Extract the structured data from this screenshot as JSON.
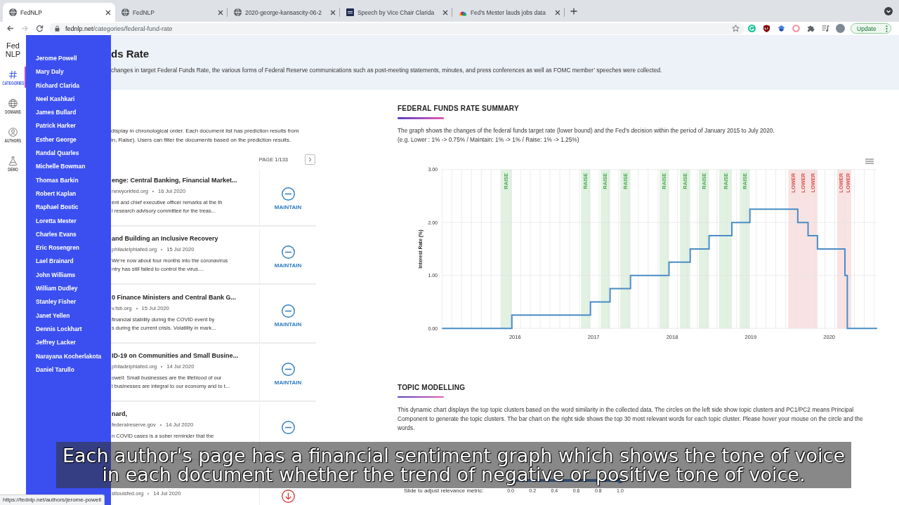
{
  "browser": {
    "tabs": [
      {
        "kind": "globe",
        "title": "FedNLP",
        "selected": true
      },
      {
        "kind": "globe",
        "title": "FedNLP",
        "selected": false
      },
      {
        "kind": "globe",
        "title": "2020-george-kansascity-06-2",
        "selected": false
      },
      {
        "kind": "seal",
        "title": "Speech by Vice Chair Clarida",
        "selected": false
      },
      {
        "kind": "fan",
        "title": "Fed's Mester lauds jobs data",
        "selected": false
      }
    ],
    "nav": [
      {
        "kind": "back",
        "disabled": false
      },
      {
        "kind": "forward",
        "disabled": true
      },
      {
        "kind": "reload",
        "disabled": false
      }
    ],
    "address": {
      "domain": "fednlp.net",
      "path": "/categories/federal-fund-rate"
    },
    "update_button": "Update"
  },
  "rail": {
    "logo_lines": [
      "Fed",
      "NLP"
    ],
    "items": [
      {
        "kind": "hash",
        "label": "CATEGORIES",
        "selected": true
      },
      {
        "kind": "globe",
        "label": "DOMAINS",
        "selected": false
      },
      {
        "kind": "person",
        "label": "AUTHORS",
        "selected": false
      },
      {
        "kind": "flask",
        "label": "DEMO",
        "selected": false
      }
    ]
  },
  "author_menu": {
    "items": [
      "Jerome Powell",
      "Mary Daly",
      "Richard Clarida",
      "Neel Kashkari",
      "James Bullard",
      "Patrick Harker",
      "Esther George",
      "Randal Quarles",
      "Michelle Bowman",
      "Thomas Barkin",
      "Robert Kaplan",
      "Raphael Bostic",
      "Loretta Mester",
      "Charles Evans",
      "Eric Rosengren",
      "Lael Brainard",
      "John Williams",
      "William Dudley",
      "Stanley Fisher",
      "Janet Yellen",
      "Dennis Lockhart",
      "Jeffrey Lacker",
      "Narayana Kocherlakota",
      "Daniel Tarullo"
    ]
  },
  "header": {
    "title": "ds Rate",
    "description": "changes in target Federal Funds Rate, the various forms of Federal Reserve communications such as post-meeting statements, minutes, and press conferences as well as FOMC member’ speeches were collected."
  },
  "documents": {
    "intro_lines": [
      "display in chronological order. Each document list has prediction results from",
      "in, Raise). Users can filter the documents based on the prediction results."
    ],
    "page": "PAGE 1/133",
    "items": [
      {
        "title": "enge: Central Banking, Financial Market...",
        "source": "newyorkfed.org",
        "date": "16 Jul 2020",
        "excerpt_lines": [
          "ent and chief executive officer remarks at the th",
          "l research advisory committee for the treas..."
        ],
        "prediction": {
          "kind": "maintain",
          "label": "MAINTAIN"
        }
      },
      {
        "title": "and Building an Inclusive Recovery",
        "source": "philadelphiafed.org",
        "date": "15 Jul 2020",
        "excerpt_lines": [
          "We’re now about four months into the coronavirus",
          "ntry has still failed to control the virus...."
        ],
        "prediction": {
          "kind": "maintain",
          "label": "MAINTAIN"
        }
      },
      {
        "title": "0 Finance Ministers and Central Bank G...",
        "source": "v.fsb.org",
        "date": "15 Jul 2020",
        "excerpt_lines": [
          "financial stability during the COVID event by",
          "s during the current crisis. Volatility in mark..."
        ],
        "prediction": {
          "kind": "maintain",
          "label": "MAINTAIN"
        }
      },
      {
        "title": "ID-19 on Communities and Small Busine...",
        "source": "philadelphiafed.org",
        "date": "14 Jul 2020",
        "excerpt_lines": [
          "owell: Small businesses are the lifeblood of our",
          "l businesses are integral to our economy and to t..."
        ],
        "prediction": {
          "kind": "maintain",
          "label": "MAINTAIN"
        }
      },
      {
        "title": "nard,",
        "source": "federalreserve.gov",
        "date": "14 Jul 2020",
        "excerpt_lines": [
          "n COVID cases is a sober reminder that the"
        ],
        "prediction": {
          "kind": "maintain"
        }
      },
      {
        "source": "stlouisfed.org",
        "date": "14 Jul 2020",
        "prediction": {
          "kind": "lower"
        }
      }
    ]
  },
  "rate_summary": {
    "title": "FEDERAL FUNDS RATE SUMMARY",
    "description_lines": [
      "The graph shows the changes of the federal funds target rate (lower bound) and the Fed’s decision within the period of January 2015 to July 2020.",
      "(e.g. Lower : 1% -> 0.75% / Maintain: 1% -> 1% / Raise: 1% -> 1.25%)"
    ],
    "chart_data": {
      "type": "line",
      "ylabel": "Interest Rate (%)",
      "x": [
        2015.07,
        2015.96,
        2015.96,
        2016.96,
        2016.96,
        2017.21,
        2017.21,
        2017.47,
        2017.47,
        2017.96,
        2017.96,
        2018.23,
        2018.23,
        2018.47,
        2018.47,
        2018.76,
        2018.76,
        2018.99,
        2018.99,
        2019.6,
        2019.6,
        2019.73,
        2019.73,
        2019.85,
        2019.85,
        2020.2,
        2020.2,
        2020.23,
        2020.23,
        2020.61
      ],
      "series": [
        {
          "color": "#4a8cc6",
          "values": [
            0,
            0,
            0.25,
            0.25,
            0.5,
            0.5,
            0.75,
            0.75,
            1,
            1,
            1.25,
            1.25,
            1.5,
            1.5,
            1.75,
            1.75,
            2,
            2,
            2.25,
            2.25,
            2,
            2,
            1.75,
            1.75,
            1.5,
            1.5,
            1,
            1,
            0,
            0
          ]
        }
      ],
      "xlim": [
        2015.07,
        2020.61
      ],
      "ylim": [
        0,
        3
      ],
      "xticks": [
        2016,
        2017,
        2018,
        2019,
        2020
      ],
      "yticks": [
        {
          "value": 0,
          "label": "0.00"
        },
        {
          "value": 1,
          "label": "1.00"
        },
        {
          "value": 2,
          "label": "2.00"
        },
        {
          "value": 3,
          "label": "3.00"
        }
      ],
      "bands": [
        {
          "axis": "x",
          "from": 2015.82,
          "to": 2015.96,
          "label": "RAISE",
          "color": "#45a84a"
        },
        {
          "axis": "x",
          "from": 2016.84,
          "to": 2016.96,
          "label": "RAISE",
          "color": "#45a84a"
        },
        {
          "axis": "x",
          "from": 2017.09,
          "to": 2017.21,
          "label": "RAISE",
          "color": "#45a84a"
        },
        {
          "axis": "x",
          "from": 2017.34,
          "to": 2017.47,
          "label": "RAISE",
          "color": "#45a84a"
        },
        {
          "axis": "x",
          "from": 2017.84,
          "to": 2017.96,
          "label": "RAISE",
          "color": "#45a84a"
        },
        {
          "axis": "x",
          "from": 2018.1,
          "to": 2018.23,
          "label": "RAISE",
          "color": "#45a84a"
        },
        {
          "axis": "x",
          "from": 2018.34,
          "to": 2018.47,
          "label": "RAISE",
          "color": "#45a84a"
        },
        {
          "axis": "x",
          "from": 2018.6,
          "to": 2018.76,
          "label": "RAISE",
          "color": "#45a84a"
        },
        {
          "axis": "x",
          "from": 2018.86,
          "to": 2018.99,
          "label": "RAISE",
          "color": "#45a84a"
        },
        {
          "axis": "x",
          "from": 2019.48,
          "to": 2019.6,
          "label": "LOWER",
          "color": "#d6504b"
        },
        {
          "axis": "x",
          "from": 2019.6,
          "to": 2019.73,
          "label": "LOWER",
          "color": "#d6504b"
        },
        {
          "axis": "x",
          "from": 2019.73,
          "to": 2019.85,
          "label": "LOWER",
          "color": "#d6504b"
        },
        {
          "axis": "x",
          "from": 2020.1,
          "to": 2020.2,
          "label": "LOWER",
          "color": "#d6504b"
        },
        {
          "axis": "x",
          "from": 2020.2,
          "to": 2020.28,
          "label": "LOWER",
          "color": "#d6504b"
        }
      ]
    }
  },
  "topic_modelling": {
    "title": "TOPIC MODELLING",
    "description": "This dynamic chart displays the top topic clusters based on the word similarity in the collected data. The circles on the left side show topic clusters and PC1/PC2 means Principal Component to generate the topic clusters. The bar chart on the right side shows the top 30 most relevant words for each topic cluster. Please hover your mouse on the circle and the words.",
    "slider": {
      "label": "Slide to adjust relevance metric:",
      "level": 1,
      "ticks": [
        "0.0",
        "0.2",
        "0.4",
        "0.6",
        "0.8",
        "1.0"
      ]
    }
  },
  "subtitle": {
    "lines": [
      "Each author's page has a financial sentiment graph which shows the tone of voice",
      "in each document whether the trend of negative or positive tone of voice."
    ]
  },
  "status_bar": {
    "url": "https://fednlp.net/authors/jerome-powell"
  }
}
